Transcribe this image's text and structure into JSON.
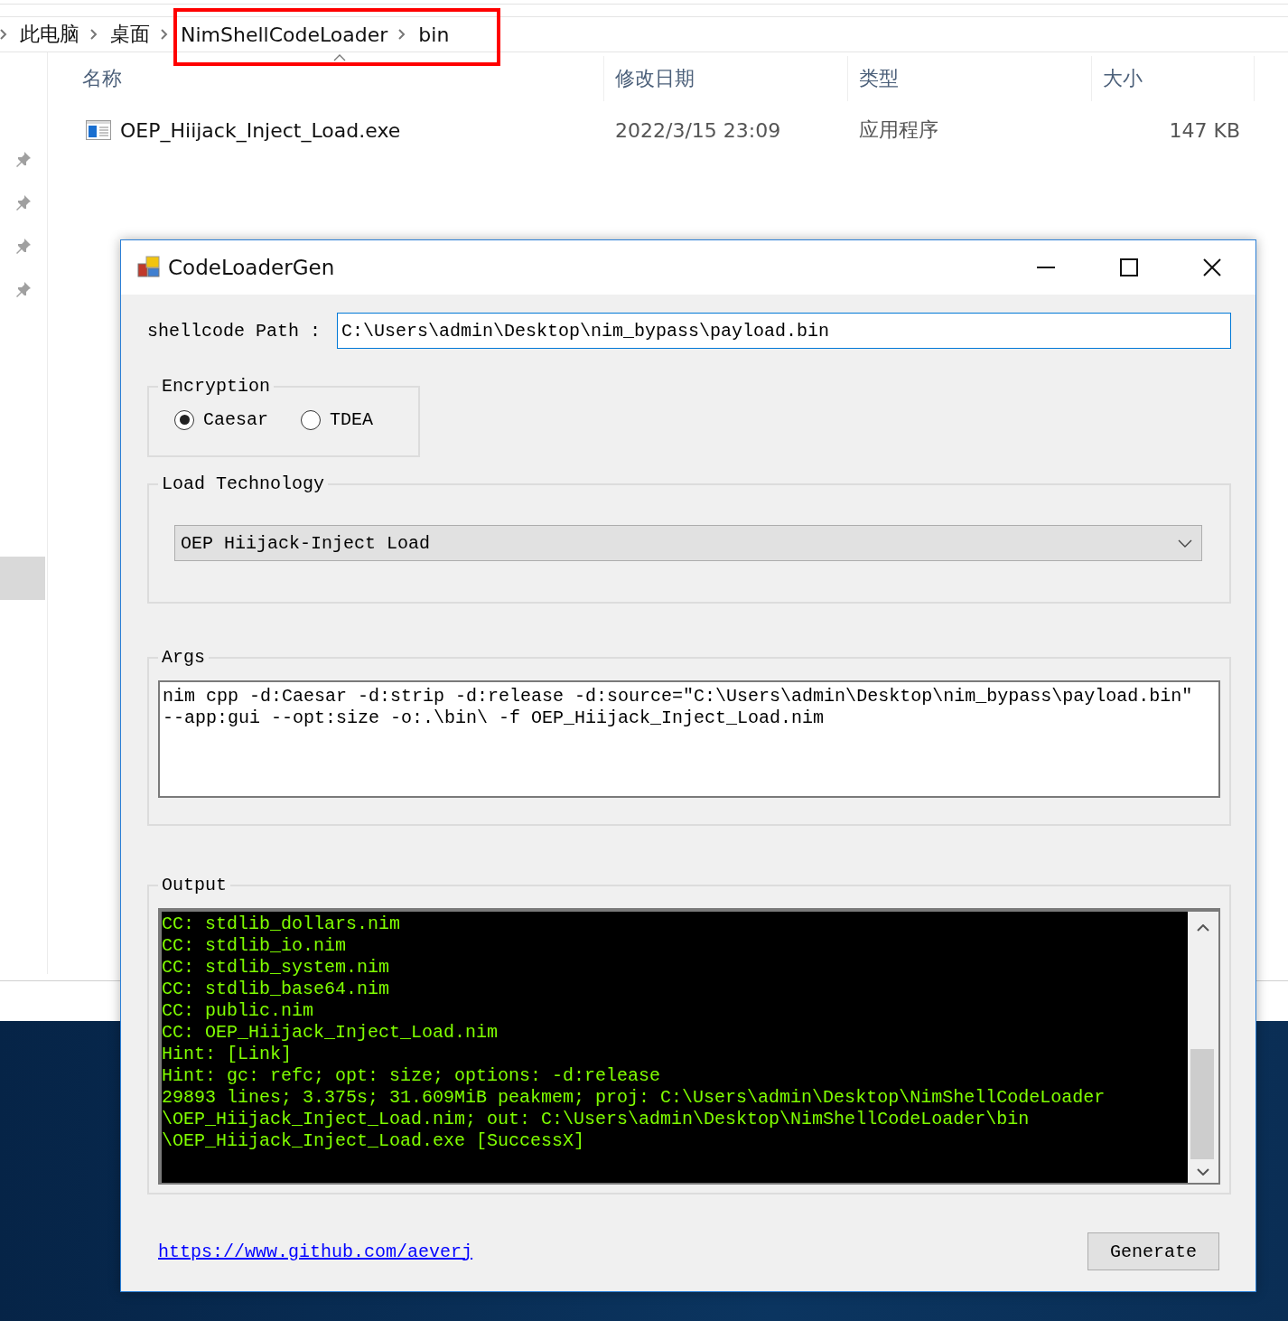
{
  "explorer": {
    "breadcrumb": [
      {
        "label": "此电脑"
      },
      {
        "label": "桌面"
      },
      {
        "label": "NimShellCodeLoader"
      },
      {
        "label": "bin"
      }
    ],
    "columns": [
      "名称",
      "修改日期",
      "类型",
      "大小"
    ],
    "files": [
      {
        "name": "OEP_Hiijack_Inject_Load.exe",
        "modified": "2022/3/15 23:09",
        "type": "应用程序",
        "size": "147 KB"
      }
    ]
  },
  "dialog": {
    "title": "CodeLoaderGen",
    "path": {
      "label": "shellcode Path :",
      "value": "C:\\Users\\admin\\Desktop\\nim_bypass\\payload.bin"
    },
    "encryption": {
      "legend": "Encryption",
      "options": [
        {
          "label": "Caesar",
          "selected": true
        },
        {
          "label": "TDEA",
          "selected": false
        }
      ]
    },
    "load": {
      "legend": "Load Technology",
      "value": "OEP Hiijack-Inject Load"
    },
    "args": {
      "legend": "Args",
      "lines": [
        "nim cpp -d:Caesar -d:strip -d:release -d:source=\"C:\\Users\\admin\\Desktop\\nim_bypass\\payload.bin\"",
        "--app:gui --opt:size -o:.\\bin\\ -f OEP_Hiijack_Inject_Load.nim"
      ]
    },
    "output": {
      "legend": "Output",
      "lines": [
        "CC: stdlib_dollars.nim",
        "CC: stdlib_io.nim",
        "CC: stdlib_system.nim",
        "CC: stdlib_base64.nim",
        "CC: public.nim",
        "CC: OEP_Hiijack_Inject_Load.nim",
        "Hint:  [Link]",
        "Hint: gc: refc; opt: size; options: -d:release",
        "29893 lines; 3.375s; 31.609MiB peakmem; proj: C:\\Users\\admin\\Desktop\\NimShellCodeLoader",
        "\\OEP_Hiijack_Inject_Load.nim; out: C:\\Users\\admin\\Desktop\\NimShellCodeLoader\\bin",
        "\\OEP_Hiijack_Inject_Load.exe [SuccessX]"
      ]
    },
    "link": "https://www.github.com/aeverj",
    "generate_button": "Generate"
  }
}
